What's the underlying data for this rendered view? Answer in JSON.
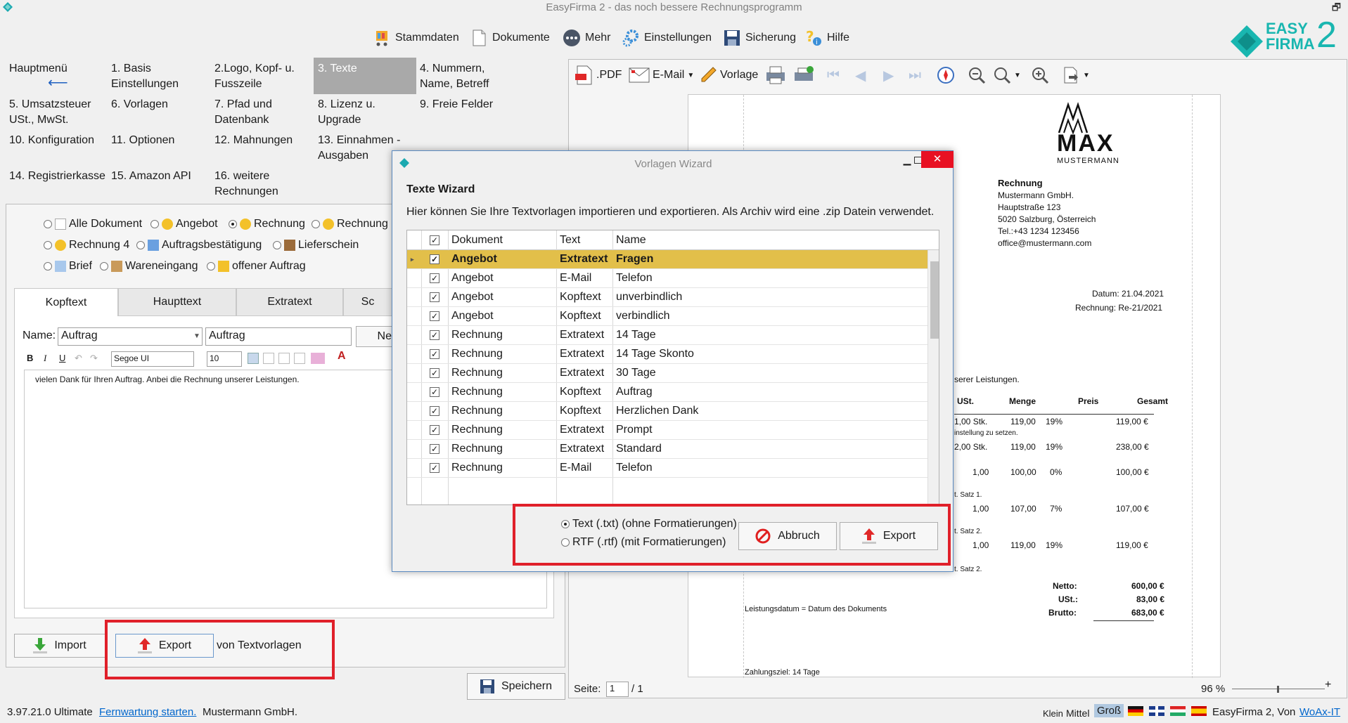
{
  "window": {
    "title": "EasyFirma 2 - das noch bessere Rechnungsprogramm",
    "restore_glyph": "🗗"
  },
  "menu": [
    {
      "label": "Stammdaten",
      "icon": "cart-icon"
    },
    {
      "label": "Dokumente",
      "icon": "document-icon"
    },
    {
      "label": "Mehr",
      "icon": "more-icon"
    },
    {
      "label": "Einstellungen",
      "icon": "gears-icon"
    },
    {
      "label": "Sicherung",
      "icon": "save-icon"
    },
    {
      "label": "Hilfe",
      "icon": "help-icon"
    }
  ],
  "logo": {
    "line1": "EASY",
    "line2": "FIRMA",
    "number": "2"
  },
  "nav": {
    "main_menu": "Hauptmenü",
    "back_arrow": "⟵",
    "items": [
      {
        "label": "1. Basis Einstellungen"
      },
      {
        "label": "2.Logo, Kopf- u. Fusszeile"
      },
      {
        "label": "3. Texte"
      },
      {
        "label": "4. Nummern, Name, Betreff"
      },
      {
        "label": "5. Umsatzsteuer USt., MwSt."
      },
      {
        "label": "6. Vorlagen"
      },
      {
        "label": "7. Pfad und Datenbank"
      },
      {
        "label": "8. Lizenz u. Upgrade"
      },
      {
        "label": "9. Freie Felder"
      },
      {
        "label": "10. Konfiguration"
      },
      {
        "label": "11. Optionen"
      },
      {
        "label": "12. Mahnungen"
      },
      {
        "label": "13. Einnahmen - Ausgaben"
      },
      {
        "label": "14. Registrierkasse"
      },
      {
        "label": "15. Amazon API"
      },
      {
        "label": "16. weitere Rechnungen"
      }
    ]
  },
  "doc_filter": {
    "options": [
      "Alle Dokument",
      "Angebot",
      "Rechnung",
      "Rechnung",
      "Rechnung 4",
      "Auftragsbestätigung",
      "Lieferschein",
      "Brief",
      "Wareneingang",
      "offener Auftrag"
    ],
    "selected_index": 2
  },
  "tabs": [
    "Kopftext",
    "Haupttext",
    "Extratext",
    "Sc"
  ],
  "editor": {
    "name_label": "Name:",
    "name_select": "Auftrag",
    "name_value": "Auftrag",
    "new_button": "Ne",
    "fmt_bold": "B",
    "fmt_italic": "I",
    "fmt_underline": "U",
    "font": "Segoe UI",
    "size": "10",
    "body_text": "vielen Dank für Ihren Auftrag. Anbei die Rechnung unserer Leistungen."
  },
  "bottom": {
    "import": "Import",
    "export": "Export",
    "suffix": "von Textvorlagen",
    "save": "Speichern"
  },
  "preview_toolbar": {
    "pdf": ".PDF",
    "email": "E-Mail",
    "vorlage": "Vorlage",
    "page_label": "Seite:",
    "page_value": "1",
    "page_total": "/ 1",
    "zoom": "96 %"
  },
  "invoice": {
    "logo_big": "MAX",
    "logo_small": "MUSTERMANN",
    "heading": "Rechnung",
    "address": [
      "Mustermann GmbH.",
      "Hauptstraße 123",
      "5020 Salzburg, Österreich",
      "Tel.:+43 1234 123456",
      "office@mustermann.com"
    ],
    "date": "Datum: 21.04.2021",
    "number": "Rechnung: Re-21/2021",
    "intro": "serer Leistungen.",
    "cols": [
      "USt.",
      "Menge",
      "Preis",
      "Gesamt"
    ],
    "rows": [
      {
        "a": "1,00 Stk.",
        "b": "119,00",
        "c": "19%",
        "d": "119,00 €"
      },
      {
        "a": "instellung zu setzen.",
        "b": "",
        "c": "",
        "d": ""
      },
      {
        "a": "2,00 Stk.",
        "b": "119,00",
        "c": "19%",
        "d": "238,00 €"
      },
      {
        "a": "1,00",
        "b": "100,00",
        "c": "0%",
        "d": "100,00 €"
      },
      {
        "a": "t. Satz 1.",
        "b": "",
        "c": "",
        "d": ""
      },
      {
        "a": "1,00",
        "b": "107,00",
        "c": "7%",
        "d": "107,00 €"
      },
      {
        "a": "t. Satz 2.",
        "b": "",
        "c": "",
        "d": ""
      },
      {
        "a": "1,00",
        "b": "119,00",
        "c": "19%",
        "d": "119,00 €"
      },
      {
        "a": "t. Satz 2.",
        "b": "",
        "c": "",
        "d": ""
      }
    ],
    "netto_label": "Netto:",
    "netto": "600,00 €",
    "ust_label": "USt.:",
    "ust": "83,00 €",
    "brutto_label": "Brutto:",
    "brutto": "683,00 €",
    "leistung": "Leistungsdatum = Datum des Dokuments",
    "zahlung": "Zahlungsziel: 14 Tage"
  },
  "dialog": {
    "title": "Vorlagen Wizard",
    "heading": "Texte Wizard",
    "description": "Hier können Sie Ihre Textvorlagen importieren und exportieren. Als Archiv wird eine .zip Datein verwendet.",
    "columns": [
      "Dokument",
      "Text",
      "Name"
    ],
    "rows": [
      {
        "doc": "Angebot",
        "text": "Extratext",
        "name": "Fragen"
      },
      {
        "doc": "Angebot",
        "text": "E-Mail",
        "name": "Telefon"
      },
      {
        "doc": "Angebot",
        "text": "Kopftext",
        "name": "unverbindlich"
      },
      {
        "doc": "Angebot",
        "text": "Kopftext",
        "name": "verbindlich"
      },
      {
        "doc": "Rechnung",
        "text": "Extratext",
        "name": "14 Tage"
      },
      {
        "doc": "Rechnung",
        "text": "Extratext",
        "name": "14 Tage Skonto"
      },
      {
        "doc": "Rechnung",
        "text": "Extratext",
        "name": "30 Tage"
      },
      {
        "doc": "Rechnung",
        "text": "Kopftext",
        "name": "Auftrag"
      },
      {
        "doc": "Rechnung",
        "text": "Kopftext",
        "name": "Herzlichen Dank"
      },
      {
        "doc": "Rechnung",
        "text": "Extratext",
        "name": "Prompt"
      },
      {
        "doc": "Rechnung",
        "text": "Extratext",
        "name": "Standard"
      },
      {
        "doc": "Rechnung",
        "text": "E-Mail",
        "name": "Telefon"
      }
    ],
    "format_txt": "Text (.txt) (ohne Formatierungen)",
    "format_rtf": "RTF (.rtf) (mit Formatierungen)",
    "cancel": "Abbruch",
    "export": "Export"
  },
  "status": {
    "version": "3.97.21.0 Ultimate",
    "remote": "Fernwartung starten.",
    "company": "Mustermann GmbH.",
    "size_small": "Klein",
    "size_mid": "Mittel",
    "size_big": "Groß",
    "credit_prefix": "EasyFirma 2, Von",
    "credit_link": "WoAx-IT"
  },
  "colors": {
    "accent_red": "#e0202a",
    "selected_row": "#e2bf4a",
    "active_nav": "#a9a9a9",
    "logo_teal": "#19b6b0"
  }
}
